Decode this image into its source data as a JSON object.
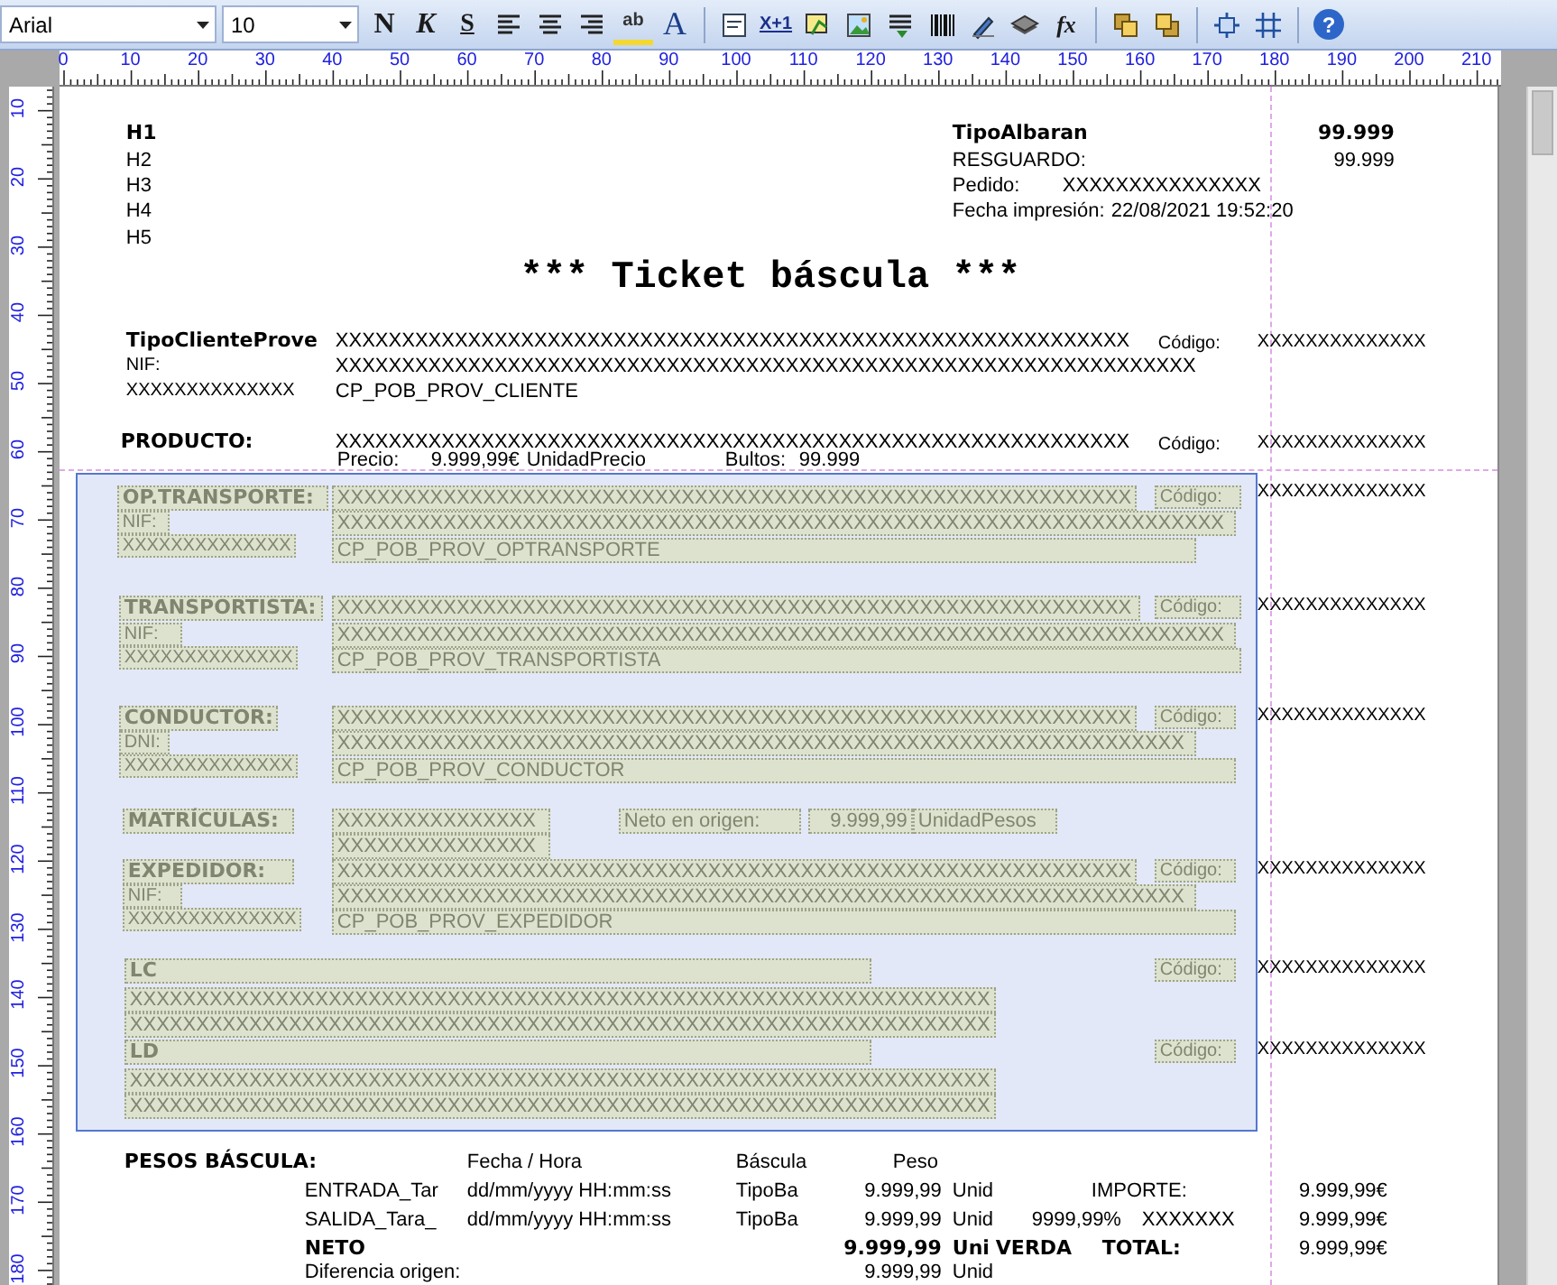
{
  "toolbar": {
    "font": "Arial",
    "size": "10",
    "items": [
      {
        "kind": "bold",
        "label": "N"
      },
      {
        "kind": "italic",
        "label": "K"
      },
      {
        "kind": "underline",
        "label": "S"
      },
      {
        "kind": "alignleft"
      },
      {
        "kind": "aligncenter"
      },
      {
        "kind": "alignright"
      },
      {
        "kind": "highlight",
        "label": "ab"
      },
      {
        "kind": "fontcolor",
        "label": "A"
      },
      {
        "kind": "separator"
      },
      {
        "kind": "textbox"
      },
      {
        "kind": "counter",
        "label": "X+1"
      },
      {
        "kind": "frame"
      },
      {
        "kind": "image"
      },
      {
        "kind": "lines"
      },
      {
        "kind": "barcode"
      },
      {
        "kind": "pen"
      },
      {
        "kind": "stack"
      },
      {
        "kind": "formula",
        "label": "fx"
      },
      {
        "kind": "separator"
      },
      {
        "kind": "bringfront"
      },
      {
        "kind": "sendback"
      },
      {
        "kind": "separator"
      },
      {
        "kind": "fit"
      },
      {
        "kind": "grid"
      },
      {
        "kind": "separator"
      },
      {
        "kind": "help",
        "label": "?"
      }
    ]
  },
  "ruler": {
    "horizontal": [
      "0",
      "10",
      "20",
      "30",
      "40",
      "50",
      "60",
      "70",
      "80",
      "90",
      "100",
      "110",
      "120",
      "130",
      "140",
      "150",
      "160",
      "170",
      "180",
      "190",
      "200",
      "210"
    ],
    "vertical": [
      "10",
      "20",
      "30",
      "40",
      "50",
      "60",
      "70",
      "80",
      "90",
      "100",
      "110",
      "120",
      "130",
      "140",
      "150",
      "160",
      "170",
      "180"
    ]
  },
  "report": {
    "fields": [
      {
        "text": "H1",
        "kind": "heading",
        "selected": false
      },
      {
        "text": "H2",
        "kind": "text",
        "selected": false
      },
      {
        "text": "H3",
        "kind": "text",
        "selected": false
      },
      {
        "text": "H4",
        "kind": "text",
        "selected": false
      },
      {
        "text": "H5",
        "kind": "text",
        "selected": false
      },
      {
        "text": "TipoAlbaran",
        "kind": "heading",
        "selected": false
      },
      {
        "text": "99.999",
        "kind": "heading",
        "selected": false
      },
      {
        "text": "RESGUARDO:",
        "kind": "text",
        "selected": false
      },
      {
        "text": "99.999",
        "kind": "text",
        "selected": false
      },
      {
        "text": "Pedido:",
        "kind": "text",
        "selected": false
      },
      {
        "text": "XXXXXXXXXXXXXXX",
        "kind": "text",
        "selected": false
      },
      {
        "text": "Fecha impresión:",
        "kind": "text",
        "selected": false
      },
      {
        "text": "22/08/2021 19:52:20",
        "kind": "text",
        "selected": false
      },
      {
        "text": "*** Ticket báscula ***",
        "kind": "title",
        "selected": false
      },
      {
        "text": "TipoClienteProve",
        "kind": "heading",
        "selected": false
      },
      {
        "text": "XXXXXXXXXXXXXXXXXXXXXXXXXXXXXXXXXXXXXXXXXXXXXXXXXXXXXXXXXXXX",
        "kind": "text",
        "selected": false
      },
      {
        "text": "Código:",
        "kind": "small",
        "selected": false
      },
      {
        "text": "XXXXXXXXXXXXXX",
        "kind": "small",
        "selected": false
      },
      {
        "text": "NIF:",
        "kind": "small",
        "selected": false
      },
      {
        "text": "XXXXXXXXXXXXXXXXXXXXXXXXXXXXXXXXXXXXXXXXXXXXXXXXXXXXXXXXXXXXXXXXX",
        "kind": "text",
        "selected": false
      },
      {
        "text": "XXXXXXXXXXXXXX",
        "kind": "small",
        "selected": false
      },
      {
        "text": "CP_POB_PROV_CLIENTE",
        "kind": "text",
        "selected": false
      },
      {
        "text": "PRODUCTO:",
        "kind": "heading",
        "selected": false
      },
      {
        "text": "XXXXXXXXXXXXXXXXXXXXXXXXXXXXXXXXXXXXXXXXXXXXXXXXXXXXXXXXXXXX",
        "kind": "text",
        "selected": false
      },
      {
        "text": "Código:",
        "kind": "small",
        "selected": false
      },
      {
        "text": "XXXXXXXXXXXXXX",
        "kind": "small",
        "selected": false
      },
      {
        "text": "Precio:",
        "kind": "text",
        "selected": false
      },
      {
        "text": "9.999,99€",
        "kind": "text",
        "selected": false
      },
      {
        "text": "UnidadPrecio",
        "kind": "text",
        "selected": false
      },
      {
        "text": "Bultos:",
        "kind": "text",
        "selected": false
      },
      {
        "text": "99.999",
        "kind": "text",
        "selected": false
      },
      {
        "text": "XXXXXXXXXXXXXX",
        "kind": "small",
        "selected": false
      },
      {
        "text": "XXXXXXXXXXXXXX",
        "kind": "small",
        "selected": false
      },
      {
        "text": "XXXXXXXXXXXXXX",
        "kind": "small",
        "selected": false
      },
      {
        "text": "XXXXXXXXXXXXXX",
        "kind": "small",
        "selected": false
      },
      {
        "text": "XXXXXXXXXXXXXX",
        "kind": "small",
        "selected": false
      },
      {
        "text": "XXXXXXXXXXXXXX",
        "kind": "small",
        "selected": false
      },
      {
        "text": "OP.TRANSPORTE:",
        "kind": "heading",
        "selected": true
      },
      {
        "text": "XXXXXXXXXXXXXXXXXXXXXXXXXXXXXXXXXXXXXXXXXXXXXXXXXXXXXXXXXXXX",
        "kind": "text",
        "selected": true
      },
      {
        "text": "Código:",
        "kind": "small",
        "selected": true
      },
      {
        "text": "NIF:",
        "kind": "small",
        "selected": true
      },
      {
        "text": "XXXXXXXXXXXXXXXXXXXXXXXXXXXXXXXXXXXXXXXXXXXXXXXXXXXXXXXXXXXXXXXXXXX",
        "kind": "text",
        "selected": true
      },
      {
        "text": "XXXXXXXXXXXXXX",
        "kind": "small",
        "selected": true
      },
      {
        "text": "CP_POB_PROV_OPTRANSPORTE",
        "kind": "text",
        "selected": true
      },
      {
        "text": "TRANSPORTISTA:",
        "kind": "heading",
        "selected": true
      },
      {
        "text": "XXXXXXXXXXXXXXXXXXXXXXXXXXXXXXXXXXXXXXXXXXXXXXXXXXXXXXXXXXXX",
        "kind": "text",
        "selected": true
      },
      {
        "text": "Código:",
        "kind": "small",
        "selected": true
      },
      {
        "text": "NIF:",
        "kind": "small",
        "selected": true
      },
      {
        "text": "XXXXXXXXXXXXXXXXXXXXXXXXXXXXXXXXXXXXXXXXXXXXXXXXXXXXXXXXXXXXXXXXXXX",
        "kind": "text",
        "selected": true
      },
      {
        "text": "XXXXXXXXXXXXXX",
        "kind": "small",
        "selected": true
      },
      {
        "text": "CP_POB_PROV_TRANSPORTISTA",
        "kind": "text",
        "selected": true
      },
      {
        "text": "CONDUCTOR:",
        "kind": "heading",
        "selected": true
      },
      {
        "text": "XXXXXXXXXXXXXXXXXXXXXXXXXXXXXXXXXXXXXXXXXXXXXXXXXXXXXXXXXXXX",
        "kind": "text",
        "selected": true
      },
      {
        "text": "Código:",
        "kind": "small",
        "selected": true
      },
      {
        "text": "DNI:",
        "kind": "small",
        "selected": true
      },
      {
        "text": "XXXXXXXXXXXXXXXXXXXXXXXXXXXXXXXXXXXXXXXXXXXXXXXXXXXXXXXXXXXXXXXX",
        "kind": "text",
        "selected": true
      },
      {
        "text": "XXXXXXXXXXXXXX",
        "kind": "small",
        "selected": true
      },
      {
        "text": "CP_POB_PROV_CONDUCTOR",
        "kind": "text",
        "selected": true
      },
      {
        "text": "MATRÍCULAS:",
        "kind": "heading",
        "selected": true
      },
      {
        "text": "XXXXXXXXXXXXXXX",
        "kind": "text",
        "selected": true
      },
      {
        "text": "XXXXXXXXXXXXXXX",
        "kind": "text",
        "selected": true
      },
      {
        "text": "Neto en origen:",
        "kind": "text",
        "selected": true
      },
      {
        "text": "9.999,99",
        "kind": "text",
        "selected": true
      },
      {
        "text": "UnidadPesos",
        "kind": "text",
        "selected": true
      },
      {
        "text": "EXPEDIDOR:",
        "kind": "heading",
        "selected": true
      },
      {
        "text": "XXXXXXXXXXXXXXXXXXXXXXXXXXXXXXXXXXXXXXXXXXXXXXXXXXXXXXXXXXXX",
        "kind": "text",
        "selected": true
      },
      {
        "text": "Código:",
        "kind": "small",
        "selected": true
      },
      {
        "text": "NIF:",
        "kind": "small",
        "selected": true
      },
      {
        "text": "XXXXXXXXXXXXXXXXXXXXXXXXXXXXXXXXXXXXXXXXXXXXXXXXXXXXXXXXXXXXXXXX",
        "kind": "text",
        "selected": true
      },
      {
        "text": "XXXXXXXXXXXXXX",
        "kind": "small",
        "selected": true
      },
      {
        "text": "CP_POB_PROV_EXPEDIDOR",
        "kind": "text",
        "selected": true
      },
      {
        "text": "LC",
        "kind": "heading",
        "selected": true
      },
      {
        "text": "Código:",
        "kind": "small",
        "selected": true
      },
      {
        "text": "XXXXXXXXXXXXXXXXXXXXXXXXXXXXXXXXXXXXXXXXXXXXXXXXXXXXXXXXXXXXXXXXX",
        "kind": "text",
        "selected": true
      },
      {
        "text": "XXXXXXXXXXXXXXXXXXXXXXXXXXXXXXXXXXXXXXXXXXXXXXXXXXXXXXXXXXXXXXXXX",
        "kind": "text",
        "selected": true
      },
      {
        "text": "LD",
        "kind": "heading",
        "selected": true
      },
      {
        "text": "Código:",
        "kind": "small",
        "selected": true
      },
      {
        "text": "XXXXXXXXXXXXXXXXXXXXXXXXXXXXXXXXXXXXXXXXXXXXXXXXXXXXXXXXXXXXXXXXX",
        "kind": "text",
        "selected": true
      },
      {
        "text": "XXXXXXXXXXXXXXXXXXXXXXXXXXXXXXXXXXXXXXXXXXXXXXXXXXXXXXXXXXXXXXXXX",
        "kind": "text",
        "selected": true
      },
      {
        "text": "PESOS BÁSCULA:",
        "kind": "heading",
        "selected": false
      },
      {
        "text": "Fecha / Hora",
        "kind": "text",
        "selected": false
      },
      {
        "text": "Báscula",
        "kind": "text",
        "selected": false
      },
      {
        "text": "Peso",
        "kind": "text",
        "selected": false
      },
      {
        "text": "ENTRADA_Tar",
        "kind": "text",
        "selected": false
      },
      {
        "text": "dd/mm/yyyy HH:mm:ss",
        "kind": "text",
        "selected": false
      },
      {
        "text": "TipoBa",
        "kind": "text",
        "selected": false
      },
      {
        "text": "9.999,99",
        "kind": "text",
        "selected": false
      },
      {
        "text": "Unid",
        "kind": "text",
        "selected": false
      },
      {
        "text": "IMPORTE:",
        "kind": "text",
        "selected": false
      },
      {
        "text": "9.999,99€",
        "kind": "text",
        "selected": false
      },
      {
        "text": "SALIDA_Tara_",
        "kind": "text",
        "selected": false
      },
      {
        "text": "dd/mm/yyyy HH:mm:ss",
        "kind": "text",
        "selected": false
      },
      {
        "text": "TipoBa",
        "kind": "text",
        "selected": false
      },
      {
        "text": "9.999,99",
        "kind": "text",
        "selected": false
      },
      {
        "text": "Unid",
        "kind": "text",
        "selected": false
      },
      {
        "text": "9999,99%",
        "kind": "text",
        "selected": false
      },
      {
        "text": "XXXXXXX",
        "kind": "text",
        "selected": false
      },
      {
        "text": "9.999,99€",
        "kind": "text",
        "selected": false
      },
      {
        "text": "NETO",
        "kind": "heading",
        "selected": false
      },
      {
        "text": "9.999,99",
        "kind": "heading",
        "selected": false
      },
      {
        "text": "Uni",
        "kind": "heading",
        "selected": false
      },
      {
        "text": "VERDA",
        "kind": "heading",
        "selected": false
      },
      {
        "text": "TOTAL:",
        "kind": "heading",
        "selected": false
      },
      {
        "text": "9.999,99€",
        "kind": "text",
        "selected": false
      },
      {
        "text": "Diferencia origen:",
        "kind": "text",
        "selected": false
      },
      {
        "text": "9.999,99",
        "kind": "text",
        "selected": false
      },
      {
        "text": "Unid",
        "kind": "text",
        "selected": false
      }
    ]
  }
}
